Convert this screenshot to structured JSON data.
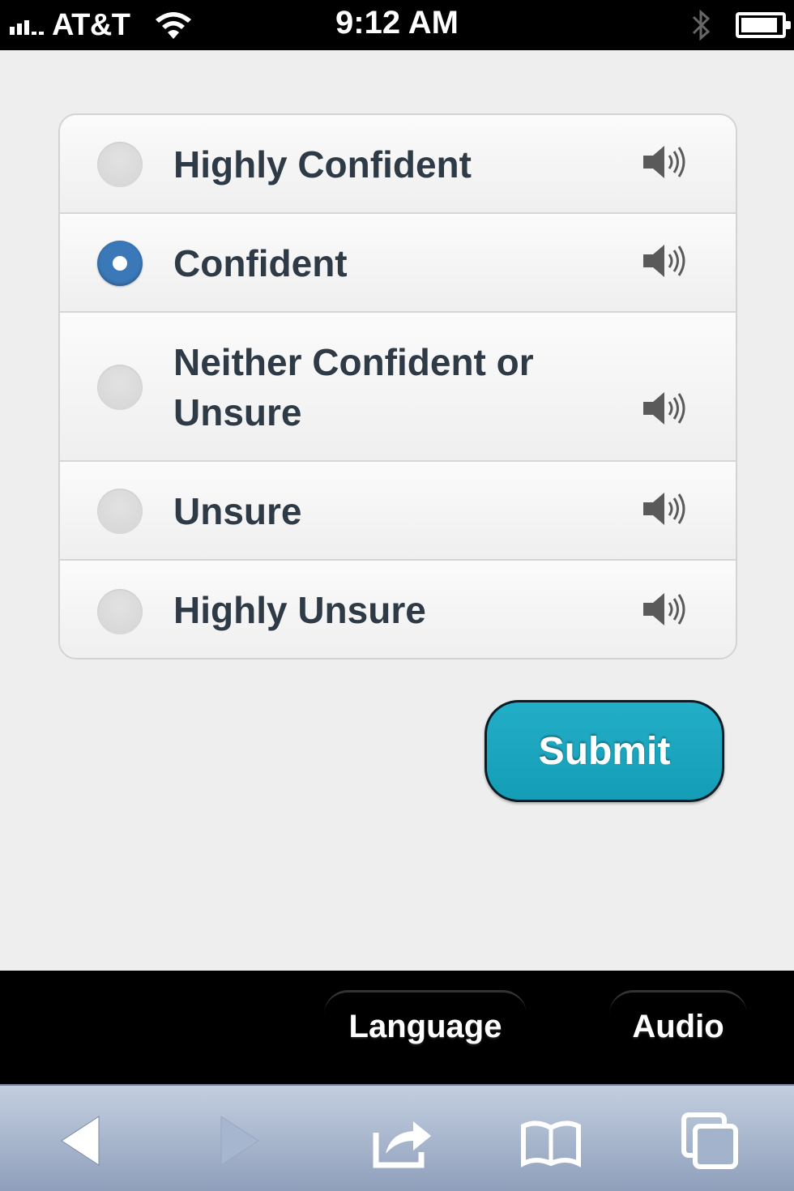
{
  "status_bar": {
    "carrier": "AT&T",
    "time": "9:12 AM",
    "icons": [
      "signal-icon",
      "wifi-icon",
      "bluetooth-icon",
      "battery-charging-icon"
    ]
  },
  "options": [
    {
      "label": "Highly Confident",
      "selected": false
    },
    {
      "label": "Confident",
      "selected": true
    },
    {
      "label": "Neither Confident or Unsure",
      "selected": false
    },
    {
      "label": "Unsure",
      "selected": false
    },
    {
      "label": "Highly Unsure",
      "selected": false
    }
  ],
  "submit": {
    "label": "Submit"
  },
  "tabs": {
    "language": "Language",
    "audio": "Audio"
  },
  "toolbar": {
    "icons": [
      "back-arrow-icon",
      "forward-arrow-icon",
      "share-icon",
      "bookmarks-icon",
      "tabs-icon"
    ]
  },
  "colors": {
    "selected_radio": "#3a78b8",
    "submit_button": "#1aa6bf",
    "label_text": "#2e3a46"
  }
}
